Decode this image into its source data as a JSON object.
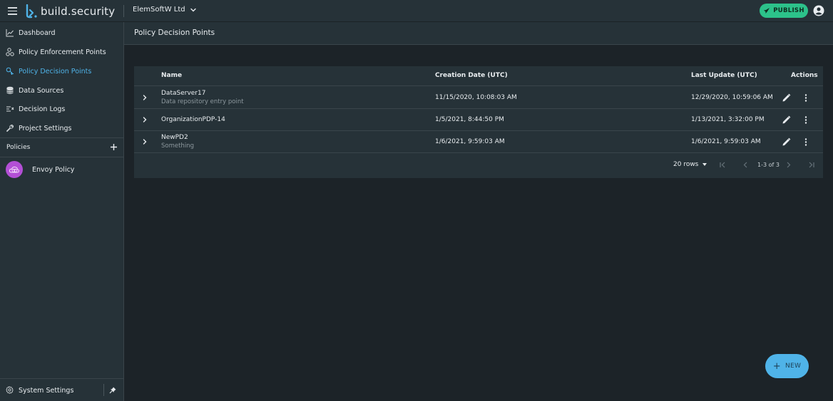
{
  "app": {
    "brand": "build.security",
    "org": "ElemSoftW Ltd",
    "publish_label": "PUBLISH"
  },
  "colors": {
    "accent": "#4fb3e8",
    "publish": "#2cc28a",
    "policy_avatar": "#b34fd6",
    "background": "#1c2328",
    "panel": "#263238"
  },
  "sidebar": {
    "items": [
      {
        "label": "Dashboard",
        "icon": "chart-line-icon",
        "active": false
      },
      {
        "label": "Policy Enforcement Points",
        "icon": "nodes-icon",
        "active": false
      },
      {
        "label": "Policy Decision Points",
        "icon": "decision-icon",
        "active": true
      },
      {
        "label": "Data Sources",
        "icon": "database-icon",
        "active": false
      },
      {
        "label": "Decision Logs",
        "icon": "logs-icon",
        "active": false
      },
      {
        "label": "Project Settings",
        "icon": "wrench-icon",
        "active": false
      }
    ],
    "policies_label": "Policies",
    "policies": [
      {
        "label": "Envoy Policy",
        "icon": "cloud-policy-icon"
      }
    ],
    "system_settings_label": "System Settings"
  },
  "page": {
    "title": "Policy Decision Points"
  },
  "table": {
    "columns": {
      "name": "Name",
      "created": "Creation Date (UTC)",
      "updated": "Last Update (UTC)",
      "actions": "Actions"
    },
    "rows": [
      {
        "name": "DataServer17",
        "description": "Data repository entry point",
        "created": "11/15/2020, 10:08:03 AM",
        "updated": "12/29/2020, 10:59:06 AM"
      },
      {
        "name": "OrganizationPDP-14",
        "description": "",
        "created": "1/5/2021, 8:44:50 PM",
        "updated": "1/13/2021, 3:32:00 PM"
      },
      {
        "name": "NewPD2",
        "description": "Something",
        "created": "1/6/2021, 9:59:03 AM",
        "updated": "1/6/2021, 9:59:03 AM"
      }
    ],
    "pagination": {
      "rows_per_page": "20 rows",
      "range": "1-3 of 3"
    }
  },
  "fab": {
    "label": "NEW"
  }
}
